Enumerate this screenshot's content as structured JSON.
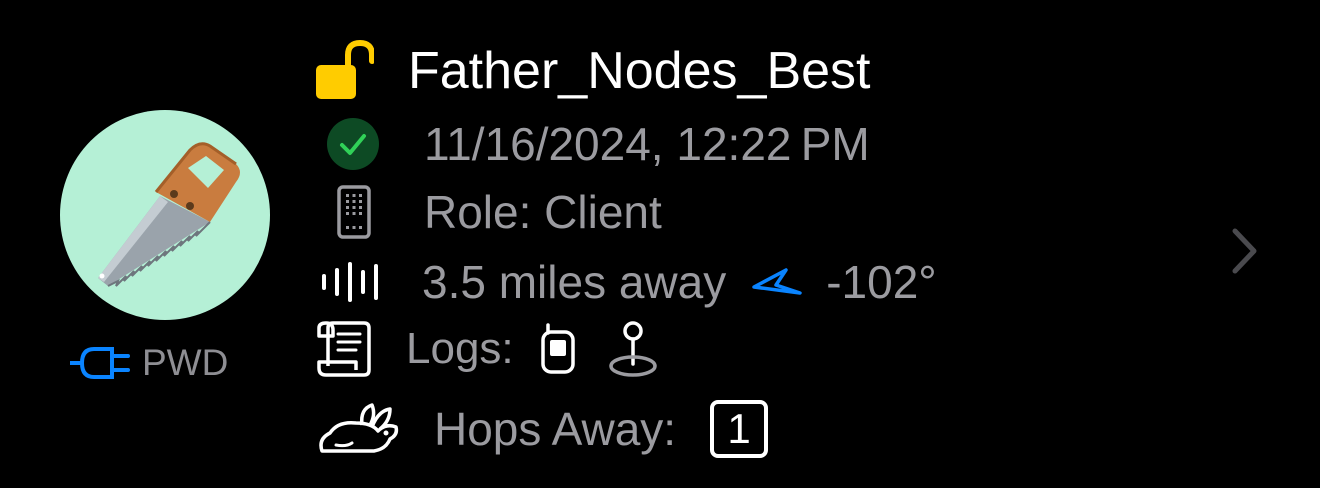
{
  "node": {
    "name": "Father_Nodes_Best",
    "last_heard": "11/16/2024, 12:22 PM",
    "role": "Role: Client",
    "distance": "3.5 miles away",
    "heading": "-102°",
    "logs_label": "Logs:",
    "hops_label": "Hops Away:",
    "hops_value": "1",
    "power_label": "PWD"
  },
  "icons": {
    "lock": "lock-open-icon",
    "status": "checkmark-circle-icon",
    "role": "device-icon",
    "distance": "waveform-icon",
    "heading": "location-arrow-icon",
    "logs": "scroll-icon",
    "device_log": "device-log-icon",
    "position_log": "map-pin-icon",
    "hops": "rabbit-icon",
    "power": "plug-icon",
    "avatar": "saw-icon",
    "chevron": "chevron-right-icon"
  },
  "colors": {
    "background": "#000000",
    "lock": "#ffcc00",
    "status_ok": "#30d158",
    "status_bg": "#0d4a24",
    "accent": "#0a84ff",
    "avatar_bg": "#b5f0d6",
    "secondary_text": "#9b9ba0"
  }
}
